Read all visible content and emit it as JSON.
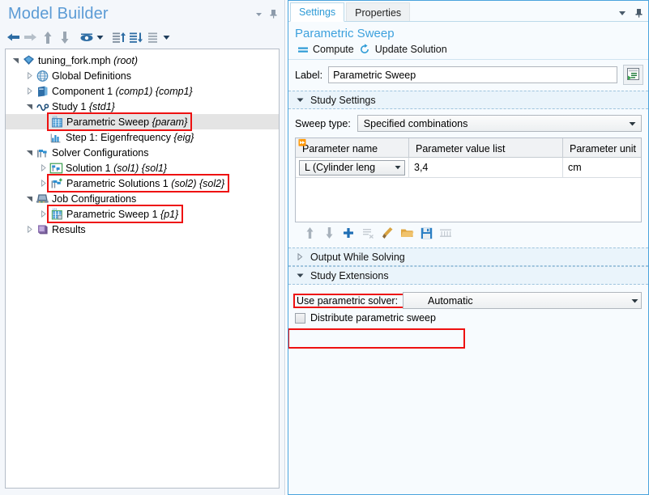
{
  "model_builder": {
    "title": "Model Builder",
    "titlebar_buttons": [
      {
        "name": "collapse-menu-icon",
        "glyph": "▾"
      },
      {
        "name": "pin-icon",
        "glyph": "📌"
      }
    ],
    "toolbar": [
      {
        "name": "back-arrow-icon",
        "tip": "Back"
      },
      {
        "name": "forward-arrow-icon",
        "tip": "Forward"
      },
      {
        "name": "up-arrow-icon",
        "tip": "Move Up"
      },
      {
        "name": "down-arrow-icon",
        "tip": "Move Down"
      },
      {
        "name": "show-eye-icon",
        "tip": "Show"
      },
      {
        "name": "show-dropdown-caret-icon",
        "tip": "Show options"
      },
      {
        "name": "collapse-all-icon",
        "tip": "Collapse All"
      },
      {
        "name": "expand-all-icon",
        "tip": "Expand All"
      },
      {
        "name": "node-list-icon",
        "tip": "Node list"
      },
      {
        "name": "node-list-caret-icon",
        "tip": "Node list options"
      }
    ],
    "tree": [
      {
        "id": "root",
        "indent": 0,
        "twist": "open",
        "icon": "mph-file-icon",
        "label": "tuning_fork.mph",
        "tags": "(root)",
        "selected": false,
        "highlight": false
      },
      {
        "id": "globaldefs",
        "indent": 1,
        "twist": "closed",
        "icon": "globe-icon",
        "label": "Global Definitions",
        "tags": "",
        "selected": false,
        "highlight": false
      },
      {
        "id": "component1",
        "indent": 1,
        "twist": "closed",
        "icon": "component-icon",
        "label": "Component 1",
        "tags": "(comp1) {comp1}",
        "selected": false,
        "highlight": false
      },
      {
        "id": "study1",
        "indent": 1,
        "twist": "open",
        "icon": "study-icon",
        "label": "Study 1",
        "tags": "{std1}",
        "selected": false,
        "highlight": false
      },
      {
        "id": "paramsweep",
        "indent": 2,
        "twist": "none",
        "icon": "parametric-sweep-icon",
        "label": "Parametric Sweep",
        "tags": "{param}",
        "selected": true,
        "highlight": true
      },
      {
        "id": "step1",
        "indent": 2,
        "twist": "none",
        "icon": "eigenfrequency-icon",
        "label": "Step 1: Eigenfrequency",
        "tags": "{eig}",
        "selected": false,
        "highlight": false
      },
      {
        "id": "solverconf",
        "indent": 1,
        "twist": "open",
        "icon": "solver-configs-icon",
        "label": "Solver Configurations",
        "tags": "",
        "selected": false,
        "highlight": false
      },
      {
        "id": "solution1",
        "indent": 2,
        "twist": "closed",
        "icon": "solution-icon",
        "label": "Solution 1",
        "tags": "(sol1) {sol1}",
        "selected": false,
        "highlight": false
      },
      {
        "id": "paramsol1",
        "indent": 2,
        "twist": "closed",
        "icon": "parametric-solution-icon",
        "label": "Parametric Solutions 1",
        "tags": "(sol2) {sol2}",
        "selected": false,
        "highlight": true
      },
      {
        "id": "jobconf",
        "indent": 1,
        "twist": "open",
        "icon": "job-configs-icon",
        "label": "Job Configurations",
        "tags": "",
        "selected": false,
        "highlight": false
      },
      {
        "id": "paramsweep1",
        "indent": 2,
        "twist": "closed",
        "icon": "parametric-sweep-job-icon",
        "label": "Parametric Sweep 1",
        "tags": "{p1}",
        "selected": false,
        "highlight": true
      },
      {
        "id": "results",
        "indent": 1,
        "twist": "closed",
        "icon": "results-icon",
        "label": "Results",
        "tags": "",
        "selected": false,
        "highlight": false
      }
    ]
  },
  "settings": {
    "tabs": [
      {
        "label": "Settings",
        "active": true
      },
      {
        "label": "Properties",
        "active": false
      }
    ],
    "tab_buttons": [
      {
        "name": "settings-menu-caret-icon",
        "glyph": "▾"
      },
      {
        "name": "pin-icon",
        "glyph": "📌"
      }
    ],
    "heading": "Parametric Sweep",
    "actions": [
      {
        "name": "compute-button",
        "label": "Compute",
        "icon": "equals-icon"
      },
      {
        "name": "update-solution-button",
        "label": "Update Solution",
        "icon": "refresh-icon"
      }
    ],
    "label_field": {
      "label": "Label:",
      "value": "Parametric Sweep",
      "button_icon": "description-icon"
    },
    "study_settings": {
      "title": "Study Settings",
      "expanded": true,
      "sweep_type": {
        "label": "Sweep type:",
        "value": "Specified combinations"
      },
      "table": {
        "columns": [
          "Parameter name",
          "Parameter value list",
          "Parameter unit"
        ],
        "rows": [
          {
            "name": "L (Cylinder leng",
            "values": "3,4",
            "unit": "cm"
          }
        ],
        "toolbar": [
          {
            "name": "move-up-icon",
            "enabled": false
          },
          {
            "name": "move-down-icon",
            "enabled": false
          },
          {
            "name": "add-icon",
            "enabled": true
          },
          {
            "name": "delete-row-icon",
            "enabled": false
          },
          {
            "name": "clear-table-icon",
            "enabled": true
          },
          {
            "name": "load-from-file-icon",
            "enabled": true
          },
          {
            "name": "save-to-file-icon",
            "enabled": true
          },
          {
            "name": "range-icon",
            "enabled": false
          }
        ]
      }
    },
    "output_while_solving": {
      "title": "Output While Solving",
      "expanded": false
    },
    "study_extensions": {
      "title": "Study Extensions",
      "expanded": true,
      "parametric_solver": {
        "label": "Use parametric solver:",
        "value": "Automatic",
        "highlight": true
      },
      "distribute": {
        "label": "Distribute parametric sweep",
        "checked": false
      }
    }
  },
  "colors": {
    "accent_blue": "#3da1dd",
    "panel_border": "#4aa3dd",
    "highlight_red": "#ee1111",
    "selection_gray": "#e4e4e4",
    "section_header_bg": "#eaf4fb",
    "mb_background": "#f4f7fb"
  }
}
